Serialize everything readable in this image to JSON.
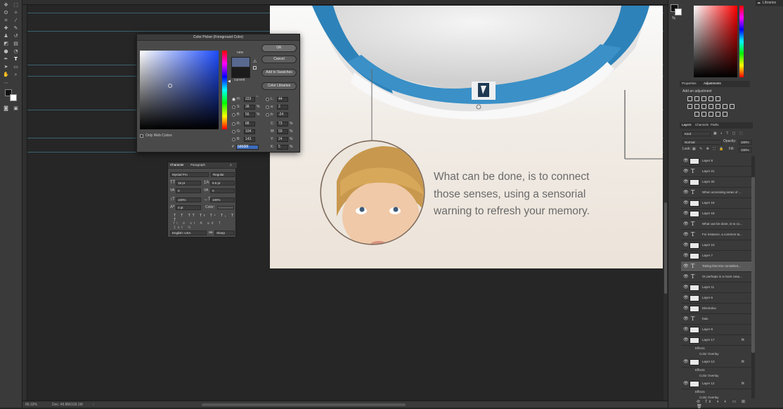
{
  "status": {
    "zoom": "66.33%",
    "doc": "Doc: 49.8M/318.1M"
  },
  "color_picker": {
    "title": "Color Picker (Foreground Color)",
    "new_label": "new",
    "current_label": "current",
    "new_color": "#58688f",
    "current_color": "#1b1b1b",
    "buttons": {
      "ok": "OK",
      "cancel": "Cancel",
      "add": "Add to Swatches",
      "libs": "Color Libraries"
    },
    "only_web": "Only Web Colors",
    "hsb": [
      {
        "l": "H:",
        "v": "223",
        "u": "°"
      },
      {
        "l": "S:",
        "v": "38",
        "u": "%"
      },
      {
        "l": "B:",
        "v": "56",
        "u": "%"
      }
    ],
    "rgb": [
      {
        "l": "R:",
        "v": "88"
      },
      {
        "l": "G:",
        "v": "104"
      },
      {
        "l": "B:",
        "v": "143"
      }
    ],
    "lab": [
      {
        "l": "L:",
        "v": "44"
      },
      {
        "l": "a:",
        "v": "2"
      },
      {
        "l": "b:",
        "v": "-24"
      }
    ],
    "cmyk": [
      {
        "l": "C:",
        "v": "73",
        "u": "%"
      },
      {
        "l": "M:",
        "v": "59",
        "u": "%"
      },
      {
        "l": "Y:",
        "v": "24",
        "u": "%"
      },
      {
        "l": "K:",
        "v": "5",
        "u": "%"
      }
    ],
    "hex_label": "#",
    "hex": "58688f"
  },
  "character": {
    "tabs": [
      "Character",
      "Paragraph"
    ],
    "font": "Myriad Pro",
    "style": "Regular",
    "size": "18 pt",
    "leading": "9.5 pt",
    "kerning": "0",
    "tracking": "0",
    "vscale": "100%",
    "hscale": "100%",
    "baseline": "0 pt",
    "color_label": "Color:",
    "language": "English: USA",
    "aa": "Sharp",
    "style_buttons": [
      "T",
      "T",
      "TT",
      "Tr",
      "T¹",
      "T₁",
      "T",
      "T"
    ],
    "ot_buttons": [
      "fi",
      "σ",
      "st",
      "A",
      "ad",
      "T",
      "1st",
      "½"
    ]
  },
  "canvas_text": "What can be done, is to connect those senses, using a sensorial warning to refresh your memory.",
  "right_panel": {
    "libraries": "Libraries",
    "adj_tabs": [
      "Properties",
      "Adjustments"
    ],
    "add_adjustment": "Add an adjustment",
    "layer_tabs": [
      "Layers",
      "Channels",
      "Paths"
    ],
    "kind": "Kind",
    "blend": "Normal",
    "opacity_label": "Opacity:",
    "opacity": "100%",
    "lock_label": "Lock:",
    "fill_label": "Fill:",
    "fill": "100%",
    "layers": [
      {
        "name": "Layer 8",
        "type": "img"
      },
      {
        "name": "Layer 21",
        "type": "text"
      },
      {
        "name": "Layer 20",
        "type": "img"
      },
      {
        "name": "When accessing areas of ...",
        "type": "text"
      },
      {
        "name": "Layer 19",
        "type": "img"
      },
      {
        "name": "Layer 18",
        "type": "img"
      },
      {
        "name": "What can be done, is to co...",
        "type": "text"
      },
      {
        "name": "For instance, a common ta...",
        "type": "text"
      },
      {
        "name": "Layer 10",
        "type": "img"
      },
      {
        "name": "Layer 7",
        "type": "img"
      },
      {
        "name": "Taking that into considera...",
        "type": "text",
        "selected": true
      },
      {
        "name": "Or perhaps in a more casu...",
        "type": "text"
      },
      {
        "name": "Layer 11",
        "type": "img"
      },
      {
        "name": "Layer 6",
        "type": "img"
      },
      {
        "name": "Electrolux",
        "type": "img"
      },
      {
        "name": "halo",
        "type": "text"
      },
      {
        "name": "Layer 9",
        "type": "img"
      },
      {
        "name": "Layer 17",
        "type": "img",
        "fx": true
      },
      {
        "name": "Layer 13",
        "type": "img",
        "fx": true
      },
      {
        "name": "Layer 12",
        "type": "img",
        "fx": true
      }
    ],
    "effects_label": "Effects",
    "color_overlay": "Color Overlay",
    "fx": "fx"
  }
}
